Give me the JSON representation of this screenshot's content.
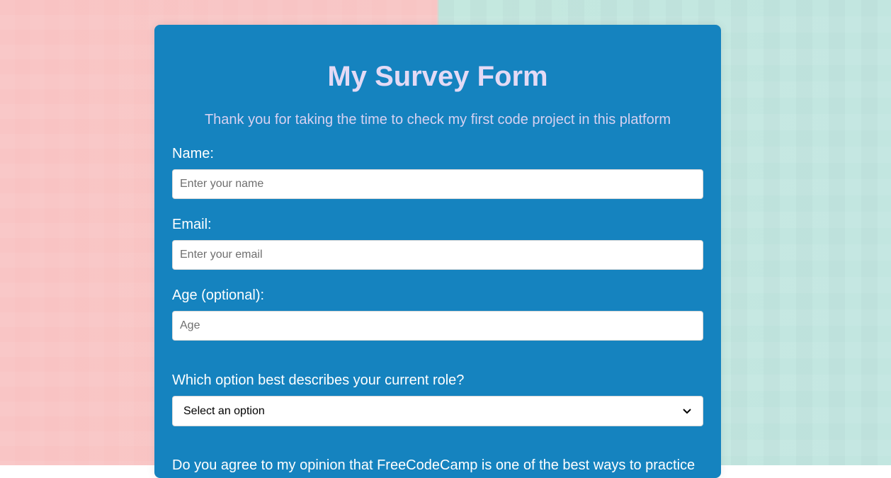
{
  "form": {
    "title": "My Survey Form",
    "description": "Thank you for taking the time to check my first code project in this platform",
    "name": {
      "label": "Name:",
      "placeholder": "Enter your name"
    },
    "email": {
      "label": "Email:",
      "placeholder": "Enter your email"
    },
    "age": {
      "label": "Age (optional):",
      "placeholder": "Age"
    },
    "role": {
      "label": "Which option best describes your current role?",
      "selected": "Select an option"
    },
    "agree_question": "Do you agree to my opinion that FreeCodeCamp is one of the best ways to practice"
  },
  "colors": {
    "card": "#1583bf",
    "title": "#e3daf5",
    "background_left": "#f9c3c3",
    "background_right": "#c4e8df"
  }
}
